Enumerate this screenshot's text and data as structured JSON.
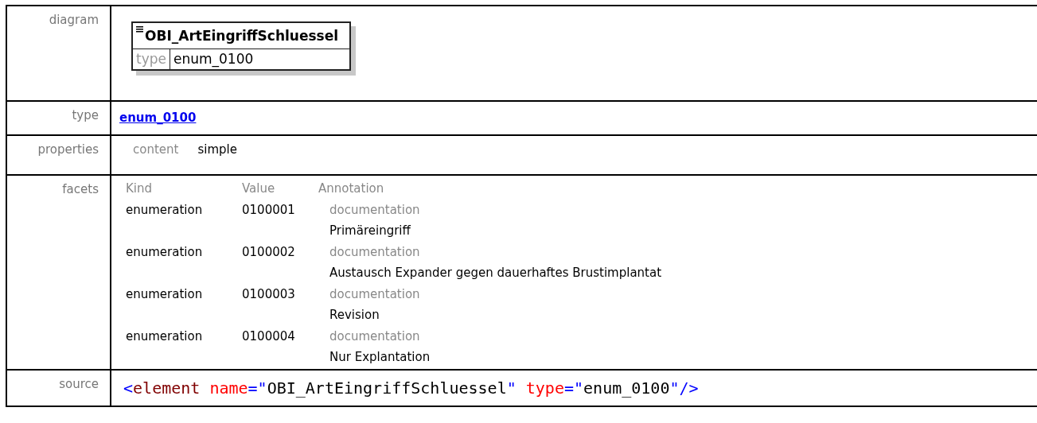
{
  "rows": [
    {
      "kind": "diagram",
      "label": "diagram",
      "element": {
        "name": "OBI_ArtEingriffSchluessel",
        "type_label": "type",
        "type": "enum_0100"
      }
    },
    {
      "kind": "link",
      "label": "type",
      "value": "enum_0100"
    },
    {
      "kind": "properties",
      "label": "properties",
      "items": [
        {
          "name": "content",
          "value": "simple"
        }
      ]
    },
    {
      "kind": "facets",
      "label": "facets",
      "columns": [
        "Kind",
        "Value",
        "Annotation"
      ],
      "facets": [
        {
          "kind": "enumeration",
          "value": "0100001",
          "annotation": "documentation",
          "text": "Primäreingriff"
        },
        {
          "kind": "enumeration",
          "value": "0100002",
          "annotation": "documentation",
          "text": "Austausch Expander gegen dauerhaftes Brustimplantat"
        },
        {
          "kind": "enumeration",
          "value": "0100003",
          "annotation": "documentation",
          "text": "Revision"
        },
        {
          "kind": "enumeration",
          "value": "0100004",
          "annotation": "documentation",
          "text": "Nur Explantation"
        }
      ]
    },
    {
      "kind": "source",
      "label": "source",
      "tokens": [
        {
          "text": "<",
          "kind": "punct"
        },
        {
          "text": "element",
          "kind": "tag"
        },
        {
          "text": " name",
          "kind": "attr"
        },
        {
          "text": "=\"",
          "kind": "punct"
        },
        {
          "text": "OBI_ArtEingriffSchluessel",
          "kind": "value"
        },
        {
          "text": "\"",
          "kind": "punct"
        },
        {
          "text": " type",
          "kind": "attr"
        },
        {
          "text": "=\"",
          "kind": "punct"
        },
        {
          "text": "enum_0100",
          "kind": "value"
        },
        {
          "text": "\"/>",
          "kind": "punct"
        }
      ]
    }
  ]
}
